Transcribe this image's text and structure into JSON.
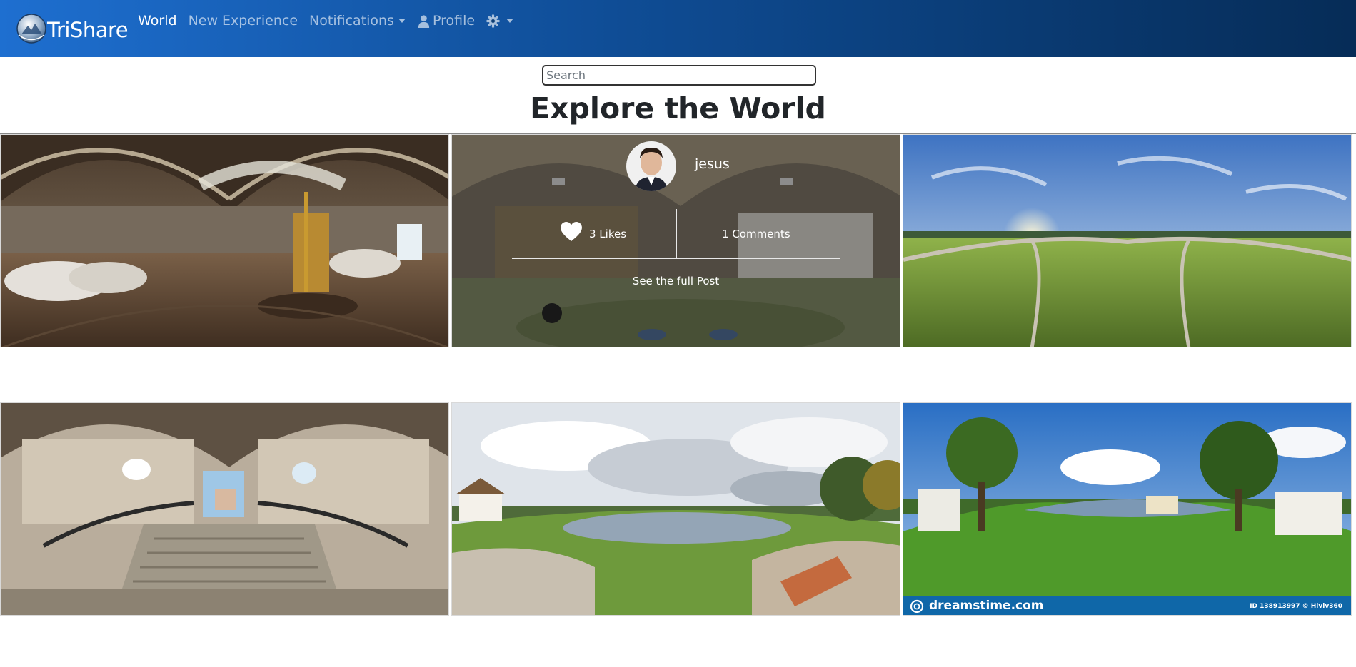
{
  "app": {
    "brand_name": "TriShare"
  },
  "nav": {
    "items": [
      {
        "label": "World",
        "active": true
      },
      {
        "label": "New Experience",
        "active": false
      },
      {
        "label": "Notifications",
        "active": false
      },
      {
        "label": "Profile",
        "active": false
      }
    ]
  },
  "search": {
    "placeholder": "Search"
  },
  "page": {
    "title": "Explore the World"
  },
  "hover_post": {
    "username": "jesus",
    "likes": "3 Likes",
    "comments": "1 Comments",
    "see_full": "See the full Post"
  },
  "watermark": {
    "site": "dreamstime.com",
    "id_text": "ID 138913997 © Hiviv360"
  },
  "colors": {
    "nav_start": "#1e6fd0",
    "nav_end": "#062c57"
  }
}
